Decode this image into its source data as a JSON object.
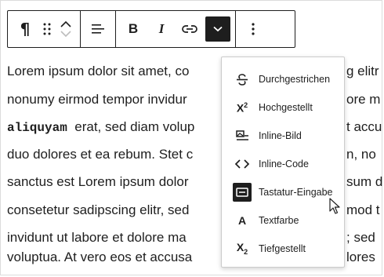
{
  "toolbar": {
    "buttons": [
      {
        "icon": "paragraph-icon",
        "label": "¶"
      },
      {
        "icon": "drag-handle-icon"
      },
      {
        "icon": "move-up-down-icon"
      },
      {
        "icon": "align-left-icon"
      },
      {
        "icon": "bold-icon",
        "label": "B"
      },
      {
        "icon": "italic-icon",
        "label": "I"
      },
      {
        "icon": "link-icon"
      },
      {
        "icon": "chevron-down-icon",
        "active": true
      },
      {
        "icon": "more-options-icon"
      }
    ]
  },
  "content": {
    "lines": [
      "Lorem ipsum dolor sit amet, co",
      "nonumy eirmod tempor invidur",
      "erat, sed diam volup",
      "duo dolores et ea rebum. Stet c",
      "sanctus est Lorem ipsum dolor",
      "consetetur sadipscing elitr, sed",
      "invidunt ut labore et dolore ma",
      "voluptua. At vero eos et accusa"
    ],
    "code_word": "aliquyam",
    "right_fragments": [
      "g elitr",
      "ore m",
      "t accu",
      "n, no",
      "sum d",
      "mod t",
      "; sed",
      "lores"
    ]
  },
  "menu": {
    "items": [
      {
        "label": "Durchgestrichen",
        "icon": "strikethrough-icon"
      },
      {
        "label": "Hochgestellt",
        "icon": "superscript-icon",
        "glyph": "X",
        "mark": "2"
      },
      {
        "label": "Inline-Bild",
        "icon": "inline-image-icon"
      },
      {
        "label": "Inline-Code",
        "icon": "code-icon",
        "glyph": "<>"
      },
      {
        "label": "Tastatur-Eingabe",
        "icon": "keyboard-icon",
        "selected": true
      },
      {
        "label": "Textfarbe",
        "icon": "text-color-icon",
        "glyph": "A"
      },
      {
        "label": "Tiefgestellt",
        "icon": "subscript-icon",
        "glyph": "X",
        "mark": "2"
      }
    ]
  }
}
